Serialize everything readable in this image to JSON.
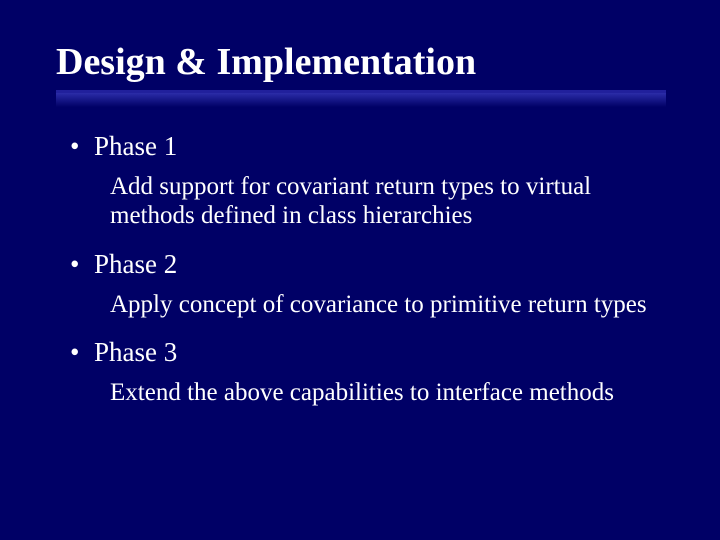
{
  "title": "Design & Implementation",
  "items": [
    {
      "label": "Phase 1",
      "desc": "Add support for covariant return types to virtual methods defined in class hierarchies"
    },
    {
      "label": "Phase 2",
      "desc": "Apply concept of covariance to primitive return types"
    },
    {
      "label": "Phase 3",
      "desc": "Extend the above capabilities to interface methods"
    }
  ]
}
